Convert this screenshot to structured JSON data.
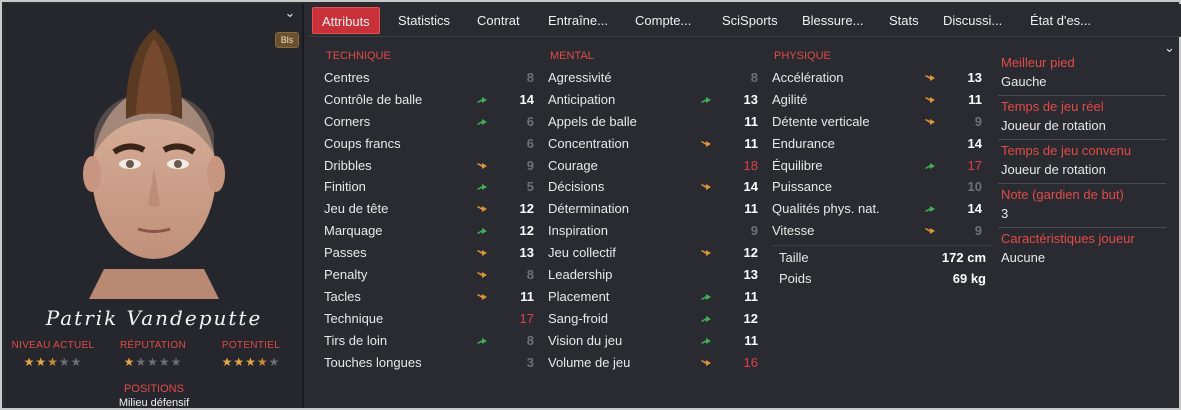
{
  "player": {
    "name": "Patrik Vandeputte",
    "badge": "Bls",
    "ratings": [
      {
        "label": "NIVEAU ACTUEL",
        "stars": 2.5
      },
      {
        "label": "RÉPUTATION",
        "stars": 1
      },
      {
        "label": "POTENTIEL",
        "stars": 3.5
      }
    ],
    "positions_label": "POSITIONS",
    "positions_value": "Milieu défensif"
  },
  "tabs": [
    {
      "label": "Attributs",
      "active": true
    },
    {
      "label": "Statistics"
    },
    {
      "label": "Contrat"
    },
    {
      "label": "Entraîne..."
    },
    {
      "label": "Compte..."
    },
    {
      "label": "SciSports"
    },
    {
      "label": "Blessure..."
    },
    {
      "label": "Stats"
    },
    {
      "label": "Discussi..."
    },
    {
      "label": "État d'es..."
    }
  ],
  "attributes": {
    "technique": {
      "title": "TECHNIQUE",
      "rows": [
        {
          "label": "Centres",
          "value": "8",
          "trend": "none",
          "tone": "lo"
        },
        {
          "label": "Contrôle de balle",
          "value": "14",
          "trend": "up",
          "tone": "hi"
        },
        {
          "label": "Corners",
          "value": "6",
          "trend": "up",
          "tone": "lo"
        },
        {
          "label": "Coups francs",
          "value": "6",
          "trend": "none",
          "tone": "lo"
        },
        {
          "label": "Dribbles",
          "value": "9",
          "trend": "down",
          "tone": "lo"
        },
        {
          "label": "Finition",
          "value": "5",
          "trend": "up",
          "tone": "lo"
        },
        {
          "label": "Jeu de tête",
          "value": "12",
          "trend": "down",
          "tone": "hi"
        },
        {
          "label": "Marquage",
          "value": "12",
          "trend": "up",
          "tone": "hi"
        },
        {
          "label": "Passes",
          "value": "13",
          "trend": "down",
          "tone": "hi"
        },
        {
          "label": "Penalty",
          "value": "8",
          "trend": "down",
          "tone": "lo"
        },
        {
          "label": "Tacles",
          "value": "11",
          "trend": "down",
          "tone": "hi"
        },
        {
          "label": "Technique",
          "value": "17",
          "trend": "none",
          "tone": "red"
        },
        {
          "label": "Tirs de loin",
          "value": "8",
          "trend": "up",
          "tone": "lo"
        },
        {
          "label": "Touches longues",
          "value": "3",
          "trend": "none",
          "tone": "lo"
        }
      ]
    },
    "mental": {
      "title": "MENTAL",
      "rows": [
        {
          "label": "Agressivité",
          "value": "8",
          "trend": "none",
          "tone": "lo"
        },
        {
          "label": "Anticipation",
          "value": "13",
          "trend": "up",
          "tone": "hi"
        },
        {
          "label": "Appels de balle",
          "value": "11",
          "trend": "none",
          "tone": "hi"
        },
        {
          "label": "Concentration",
          "value": "11",
          "trend": "down",
          "tone": "hi"
        },
        {
          "label": "Courage",
          "value": "18",
          "trend": "none",
          "tone": "red"
        },
        {
          "label": "Décisions",
          "value": "14",
          "trend": "down",
          "tone": "hi"
        },
        {
          "label": "Détermination",
          "value": "11",
          "trend": "none",
          "tone": "hi"
        },
        {
          "label": "Inspiration",
          "value": "9",
          "trend": "none",
          "tone": "lo"
        },
        {
          "label": "Jeu collectif",
          "value": "12",
          "trend": "down",
          "tone": "hi"
        },
        {
          "label": "Leadership",
          "value": "13",
          "trend": "none",
          "tone": "hi"
        },
        {
          "label": "Placement",
          "value": "11",
          "trend": "up",
          "tone": "hi"
        },
        {
          "label": "Sang-froid",
          "value": "12",
          "trend": "up",
          "tone": "hi"
        },
        {
          "label": "Vision du jeu",
          "value": "11",
          "trend": "up",
          "tone": "hi"
        },
        {
          "label": "Volume de jeu",
          "value": "16",
          "trend": "down",
          "tone": "red"
        }
      ]
    },
    "physique": {
      "title": "PHYSIQUE",
      "rows": [
        {
          "label": "Accélération",
          "value": "13",
          "trend": "down",
          "tone": "hi"
        },
        {
          "label": "Agilité",
          "value": "11",
          "trend": "down",
          "tone": "hi"
        },
        {
          "label": "Détente verticale",
          "value": "9",
          "trend": "down",
          "tone": "lo"
        },
        {
          "label": "Endurance",
          "value": "14",
          "trend": "none",
          "tone": "hi"
        },
        {
          "label": "Équilibre",
          "value": "17",
          "trend": "up",
          "tone": "red"
        },
        {
          "label": "Puissance",
          "value": "10",
          "trend": "none",
          "tone": "lo"
        },
        {
          "label": "Qualités phys. nat.",
          "value": "14",
          "trend": "up",
          "tone": "hi"
        },
        {
          "label": "Vitesse",
          "value": "9",
          "trend": "down",
          "tone": "lo"
        }
      ],
      "extra": [
        {
          "label": "Taille",
          "value": "172 cm"
        },
        {
          "label": "Poids",
          "value": "69 kg"
        }
      ]
    }
  },
  "info": [
    {
      "label": "Meilleur pied",
      "value": "Gauche"
    },
    {
      "label": "Temps de jeu réel",
      "value": "Joueur de rotation"
    },
    {
      "label": "Temps de jeu convenu",
      "value": "Joueur de rotation"
    },
    {
      "label": "Note (gardien de but)",
      "value": "3"
    },
    {
      "label": "Caractéristiques joueur",
      "value": "Aucune"
    }
  ],
  "colors": {
    "accent": "#c8313a",
    "label_red": "#e04a4a",
    "trend_up": "#3fae5a",
    "trend_down": "#e0933a",
    "star": "#e3a648"
  }
}
